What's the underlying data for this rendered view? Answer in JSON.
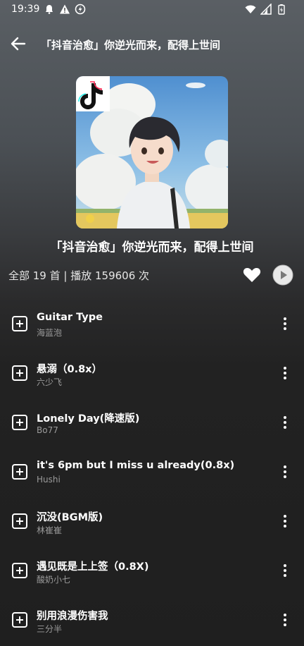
{
  "status": {
    "time": "19:39"
  },
  "header": {
    "title": "「抖音治愈」你逆光而来，配得上世间"
  },
  "playlist": {
    "title": "「抖音治愈」你逆光而来，配得上世间",
    "meta": "全部 19 首 | 播放 159606 次"
  },
  "songs": [
    {
      "title": "Guitar Type",
      "artist": "海蓝泡"
    },
    {
      "title": "悬溺（0.8x）",
      "artist": "六少飞"
    },
    {
      "title": "Lonely Day(降速版)",
      "artist": "Bo77"
    },
    {
      "title": "it's 6pm but I miss u already(0.8x)",
      "artist": "Hushi"
    },
    {
      "title": "沉没(BGM版)",
      "artist": "林崔崔"
    },
    {
      "title": "遇见既是上上签（0.8X)",
      "artist": "酸奶小七"
    },
    {
      "title": "别用浪漫伤害我",
      "artist": "三分半"
    }
  ],
  "icons": {
    "back": "arrow-left-icon",
    "heart": "heart-icon",
    "play": "play-circle-icon",
    "add": "plus-square-icon",
    "more": "more-vertical-icon"
  },
  "colors": {
    "accent": "#ffffff",
    "artist_text": "#9b9b9b"
  }
}
